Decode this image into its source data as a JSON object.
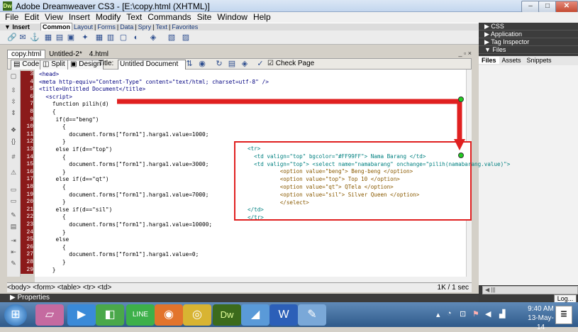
{
  "window": {
    "app_icon": "Dw",
    "title": "Adobe Dreamweaver CS3 - [E:\\copy.html (XHTML)]",
    "min_label": "–",
    "max_label": "□",
    "close_label": "✕"
  },
  "menu": [
    "File",
    "Edit",
    "View",
    "Insert",
    "Modify",
    "Text",
    "Commands",
    "Site",
    "Window",
    "Help"
  ],
  "insertbar": {
    "label": "▼ Insert",
    "tabs": [
      "Common",
      "Layout",
      "Forms",
      "Data",
      "Spry",
      "Text",
      "Favorites"
    ]
  },
  "doc_tabs": [
    "copy.html",
    "Untitled-2*",
    "4.html"
  ],
  "doc_window_ctrl": "_ ▫ ×",
  "doctoolbar": {
    "code_label": "Code",
    "split_label": "Split",
    "design_label": "Design",
    "title_label": "Title:",
    "title_value": "Untitled Document",
    "check_page_label": "Check Page"
  },
  "line_numbers": [
    "3",
    "4",
    "5",
    "6",
    "7",
    "8",
    "9",
    "10",
    "11",
    "12",
    "13",
    "14",
    "15",
    "16",
    "17",
    "18",
    "19",
    "20",
    "21",
    "22",
    "23",
    "24",
    "25",
    "26",
    "27",
    "28",
    "29"
  ],
  "code_lines": [
    "<head>",
    "<meta http-equiv=\"Content-Type\" content=\"text/html; charset=utf-8\" />",
    "<title>Untitled Document</title>",
    "  <script>",
    "    function pilih(d)",
    "    {",
    "     if(d==\"beng\")",
    "       {",
    "         document.forms[\"form1\"].harga1.value=1000;",
    "       }",
    "     else if(d==\"top\")",
    "       {",
    "         document.forms[\"form1\"].harga1.value=3000;",
    "       }",
    "     else if(d==\"qt\")",
    "       {",
    "         document.forms[\"form1\"].harga1.value=7000;",
    "       }",
    "     else if(d==\"sil\")",
    "       {",
    "         document.forms[\"form1\"].harga1.value=10000;",
    "       }",
    "     else",
    "       {",
    "         document.forms[\"form1\"].harga1.value=0;",
    "       }",
    "    }"
  ],
  "overlay_lines": [
    "<tr>",
    "  <td valign=\"top\" bgcolor=\"#FF99FF\"> Nama Barang </td>",
    "  <td valign=\"top\"> <select name=\"namabarang\" onchange=\"pilih(namabarang.value)\">",
    "          <option value=\"beng\"> Beng-beng </option>",
    "          <option value=\"top\"> Top 10 </option>",
    "          <option value=\"qt\"> QTela </option>",
    "          <option value=\"sil\"> Silver Queen </option>",
    "          </select>",
    "</td>",
    "</tr>"
  ],
  "statusbar": {
    "breadcrumb": "<body> <form> <table> <tr> <td>",
    "size": "1K / 1 sec"
  },
  "properties_label": "▶ Properties",
  "right_panel": {
    "headers": [
      "▶ CSS",
      "▶ Application",
      "▶ Tag Inspector",
      "▼ Files"
    ],
    "files_tabs": [
      "Files",
      "Assets",
      "Snippets"
    ],
    "scroll_label": "◀  |||",
    "log_label": "Log..."
  },
  "taskbar": {
    "time": "9:40 AM",
    "date": "13-May-14",
    "showdesk_label": "☰"
  },
  "colors": {
    "overlay_border": "#e02020",
    "arrow": "#e02020",
    "gutter": "#8b1a1a"
  }
}
